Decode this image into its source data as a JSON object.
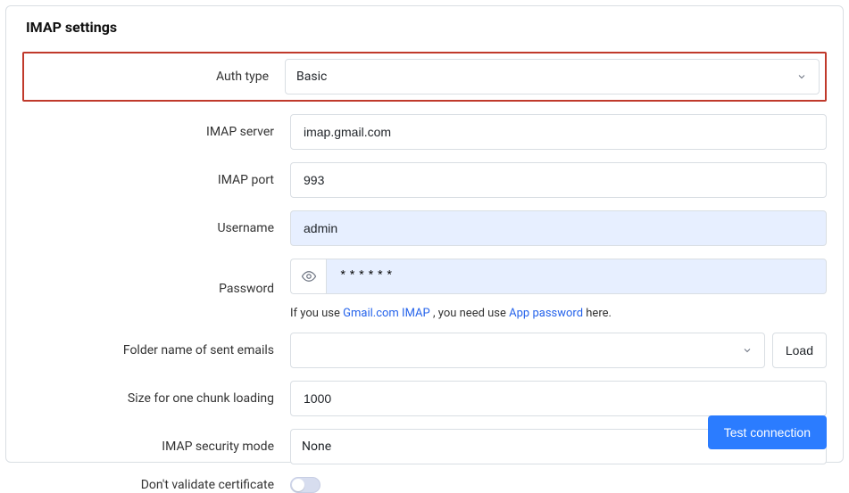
{
  "title": "IMAP settings",
  "fields": {
    "auth_type": {
      "label": "Auth type",
      "value": "Basic"
    },
    "server": {
      "label": "IMAP server",
      "value": "imap.gmail.com"
    },
    "port": {
      "label": "IMAP port",
      "value": "993"
    },
    "username": {
      "label": "Username",
      "value": "admin"
    },
    "password": {
      "label": "Password",
      "value": "******"
    },
    "folder": {
      "label": "Folder name of sent emails",
      "value": ""
    },
    "chunk": {
      "label": "Size for one chunk loading",
      "value": "1000"
    },
    "security": {
      "label": "IMAP security mode",
      "value": "None"
    },
    "validate": {
      "label": "Don't validate certificate",
      "value": false
    }
  },
  "hint": {
    "p1": "If you use ",
    "link1": "Gmail.com IMAP",
    "p2": " , you need use ",
    "link2": "App password",
    "p3": " here."
  },
  "buttons": {
    "load": "Load",
    "test": "Test connection"
  }
}
